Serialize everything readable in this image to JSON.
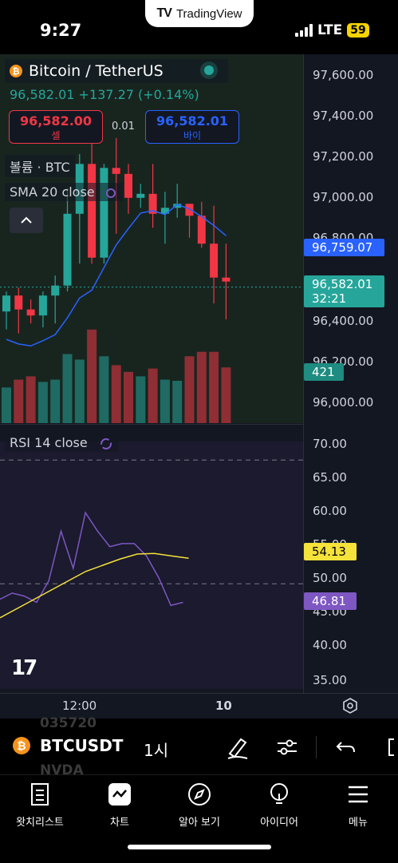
{
  "status_bar": {
    "time": "9:27",
    "app_pill": "TradingView",
    "network": "LTE",
    "battery": "59"
  },
  "header": {
    "title": "Bitcoin / TetherUS",
    "last_price": "96,582.01",
    "change": "+137.27 (+0.14%)",
    "sell_price": "96,582.00",
    "sell_label": "셀",
    "spread": "0.01",
    "buy_price": "96,582.01",
    "buy_label": "바이",
    "volume_label": "볼륨 · BTC",
    "sma_label": "SMA 20 close",
    "rsi_label": "RSI 14 close"
  },
  "price_axis": [
    "97,600.00",
    "97,400.00",
    "97,200.00",
    "97,000.00",
    "96,800.00",
    "96,400.00",
    "96,200.00",
    "96,000.00"
  ],
  "tags": {
    "sma_value": "96,759.07",
    "current_price": "96,582.01",
    "countdown": "32:21",
    "volume": "421",
    "rsi_ma": "54.13",
    "rsi": "46.81"
  },
  "rsi_axis": [
    "70.00",
    "65.00",
    "60.00",
    "55.00",
    "50.00",
    "45.00",
    "40.00",
    "35.00"
  ],
  "time_axis": {
    "t1": "12:00",
    "t2": "10"
  },
  "toolbar": {
    "symbol": "BTCUSDT",
    "interval": "1시",
    "ghost1": "035720",
    "ghost2": "NVDA"
  },
  "nav": [
    {
      "label": "왓치리스트",
      "icon": "watchlist-icon"
    },
    {
      "label": "차트",
      "icon": "chart-icon"
    },
    {
      "label": "알아 보기",
      "icon": "explore-icon"
    },
    {
      "label": "아이디어",
      "icon": "ideas-icon"
    },
    {
      "label": "메뉴",
      "icon": "menu-icon"
    }
  ],
  "colors": {
    "up": "#26a69a",
    "down": "#f23645",
    "sma": "#2962ff",
    "rsi": "#7e57c2",
    "rsi_ma": "#f5e23a"
  },
  "chart_data": {
    "type": "candlestick",
    "interval": "1h",
    "price_range": [
      95900,
      97750
    ],
    "candles": [
      {
        "o": 96460,
        "h": 96560,
        "l": 96370,
        "c": 96540
      },
      {
        "o": 96540,
        "h": 96580,
        "l": 96350,
        "c": 96470
      },
      {
        "o": 96470,
        "h": 96520,
        "l": 96400,
        "c": 96440
      },
      {
        "o": 96440,
        "h": 96560,
        "l": 96380,
        "c": 96540
      },
      {
        "o": 96540,
        "h": 96640,
        "l": 96400,
        "c": 96590
      },
      {
        "o": 96590,
        "h": 97080,
        "l": 96560,
        "c": 96950
      },
      {
        "o": 96950,
        "h": 97250,
        "l": 96700,
        "c": 97200
      },
      {
        "o": 97200,
        "h": 97320,
        "l": 96700,
        "c": 96730
      },
      {
        "o": 96730,
        "h": 97200,
        "l": 96700,
        "c": 97180
      },
      {
        "o": 97180,
        "h": 97330,
        "l": 96850,
        "c": 97150
      },
      {
        "o": 97150,
        "h": 97200,
        "l": 96950,
        "c": 97030
      },
      {
        "o": 97030,
        "h": 97100,
        "l": 96980,
        "c": 97050
      },
      {
        "o": 97050,
        "h": 97200,
        "l": 96880,
        "c": 96950
      },
      {
        "o": 96950,
        "h": 97060,
        "l": 96800,
        "c": 96980
      },
      {
        "o": 96980,
        "h": 97100,
        "l": 96930,
        "c": 97000
      },
      {
        "o": 97000,
        "h": 97000,
        "l": 96830,
        "c": 96940
      },
      {
        "o": 96940,
        "h": 97010,
        "l": 96780,
        "c": 96800
      },
      {
        "o": 96800,
        "h": 96990,
        "l": 96500,
        "c": 96630
      },
      {
        "o": 96630,
        "h": 96800,
        "l": 96420,
        "c": 96610
      }
    ],
    "volume": [
      160,
      195,
      210,
      185,
      195,
      310,
      285,
      420,
      300,
      260,
      230,
      210,
      245,
      195,
      190,
      300,
      320,
      320,
      250
    ],
    "rsi": [
      47.5,
      48.5,
      48.0,
      47.0,
      50.5,
      58.5,
      52.5,
      61.5,
      58.5,
      56.0,
      56.5,
      56.5,
      54.5,
      51.0,
      46.5,
      47.0
    ],
    "rsi_ma": [
      44.5,
      46.0,
      47.5,
      49.0,
      50.5,
      52.0,
      53.0,
      54.0,
      54.8,
      54.9,
      54.5,
      54.13
    ],
    "rsi_range": [
      33,
      73
    ]
  }
}
